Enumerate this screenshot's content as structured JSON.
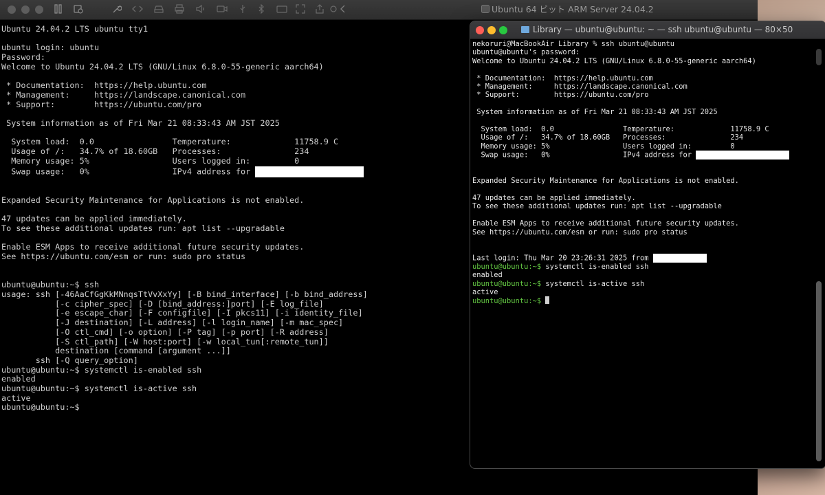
{
  "vm": {
    "title": "Ubuntu 64 ビット ARM Server 24.04.2",
    "console_lines": [
      "Ubuntu 24.04.2 LTS ubuntu tty1",
      "",
      "ubuntu login: ubuntu",
      "Password:",
      "Welcome to Ubuntu 24.04.2 LTS (GNU/Linux 6.8.0-55-generic aarch64)",
      "",
      " * Documentation:  https://help.ubuntu.com",
      " * Management:     https://landscape.canonical.com",
      " * Support:        https://ubuntu.com/pro",
      "",
      " System information as of Fri Mar 21 08:33:43 AM JST 2025",
      "",
      "  System load:  0.0                Temperature:             11758.9 C",
      "  Usage of /:   34.7% of 18.60GB   Processes:               234",
      "  Memory usage: 5%                 Users logged in:         0",
      "  Swap usage:   0%                 IPv4 address for ",
      "",
      "",
      "Expanded Security Maintenance for Applications is not enabled.",
      "",
      "47 updates can be applied immediately.",
      "To see these additional updates run: apt list --upgradable",
      "",
      "Enable ESM Apps to receive additional future security updates.",
      "See https://ubuntu.com/esm or run: sudo pro status",
      "",
      "",
      "ubuntu@ubuntu:~$ ssh",
      "usage: ssh [-46AaCfGgKkMNnqsTtVvXxYy] [-B bind_interface] [-b bind_address]",
      "           [-c cipher_spec] [-D [bind_address:]port] [-E log_file]",
      "           [-e escape_char] [-F configfile] [-I pkcs11] [-i identity_file]",
      "           [-J destination] [-L address] [-l login_name] [-m mac_spec]",
      "           [-O ctl_cmd] [-o option] [-P tag] [-p port] [-R address]",
      "           [-S ctl_path] [-W host:port] [-w local_tun[:remote_tun]]",
      "           destination [command [argument ...]]",
      "       ssh [-Q query_option]",
      "ubuntu@ubuntu:~$ systemctl is-enabled ssh",
      "enabled",
      "ubuntu@ubuntu:~$ systemctl is-active ssh",
      "active",
      "ubuntu@ubuntu:~$"
    ]
  },
  "terminal": {
    "title": "Library — ubuntu@ubuntu: ~ — ssh ubuntu@ubuntu — 80×50",
    "lines_before_prompts": [
      "nekoruri@MacBookAir Library % ssh ubuntu@ubuntu",
      "ubuntu@ubuntu's password:",
      "Welcome to Ubuntu 24.04.2 LTS (GNU/Linux 6.8.0-55-generic aarch64)",
      "",
      " * Documentation:  https://help.ubuntu.com",
      " * Management:     https://landscape.canonical.com",
      " * Support:        https://ubuntu.com/pro",
      "",
      " System information as of Fri Mar 21 08:33:43 AM JST 2025",
      "",
      "  System load:  0.0                Temperature:             11758.9 C",
      "  Usage of /:   34.7% of 18.60GB   Processes:               234",
      "  Memory usage: 5%                 Users logged in:         0",
      "  Swap usage:   0%                 IPv4 address for ",
      "",
      "",
      "Expanded Security Maintenance for Applications is not enabled.",
      "",
      "47 updates can be applied immediately.",
      "To see these additional updates run: apt list --upgradable",
      "",
      "Enable ESM Apps to receive additional future security updates.",
      "See https://ubuntu.com/esm or run: sudo pro status",
      "",
      "",
      "Last login: Thu Mar 20 23:26:31 2025 from "
    ],
    "session": [
      {
        "prompt": "ubuntu@ubuntu:~$",
        "command": " systemctl is-enabled ssh"
      },
      {
        "output": "enabled"
      },
      {
        "prompt": "ubuntu@ubuntu:~$",
        "command": " systemctl is-active ssh"
      },
      {
        "output": "active"
      },
      {
        "prompt": "ubuntu@ubuntu:~$",
        "command": " "
      }
    ]
  },
  "colors": {
    "prompt_green": "#63c742",
    "traffic_red": "#ff5f57",
    "traffic_yellow": "#febc2e",
    "traffic_green": "#28c840"
  }
}
